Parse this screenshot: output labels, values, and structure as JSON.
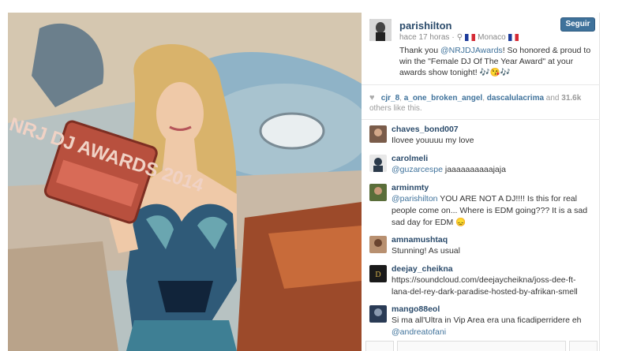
{
  "post": {
    "username": "parishilton",
    "time": "hace 17 horas",
    "location": "Monaco",
    "follow_label": "Seguir",
    "caption_prefix": "Thank you ",
    "caption_mention": "@NRJDJAwards",
    "caption_rest": "! So honored & proud to win the \"Female DJ Of The Year Award\" at your awards show tonight! 🎶😘🎶"
  },
  "likes": {
    "user1": "cjr_8",
    "user2": "a_one_broken_angel",
    "user3": "dascalulacrima",
    "and_label": "and",
    "count": "31.6k",
    "suffix": "others like this."
  },
  "comments": [
    {
      "user": "chaves_bond007",
      "text": "Ilovee youuuu my love"
    },
    {
      "user": "carolmeli",
      "mention": "@guzarcespe",
      "text": " jaaaaaaaaaajaja"
    },
    {
      "user": "arminmty",
      "mention": "@parishilton",
      "text": " YOU ARE NOT A DJ!!!! Is this for real people come on... Where is EDM going??? It is a sad sad day for EDM 😞"
    },
    {
      "user": "amnamushtaq",
      "text": "Stunning! As usual"
    },
    {
      "user": "deejay_cheikna",
      "text": "https://soundcloud.com/deejaycheikna/joss-dee-ft-lana-del-rey-dark-paradise-hosted-by-afrikan-smell"
    },
    {
      "user": "mango88eol",
      "text": "Si ma all'Ultra in Vip Area era una ficadiperridere eh ",
      "mention_after": "@andreatofani"
    }
  ],
  "photo": {
    "trophy_text": "NRJ DJ AWARDS 2014"
  }
}
